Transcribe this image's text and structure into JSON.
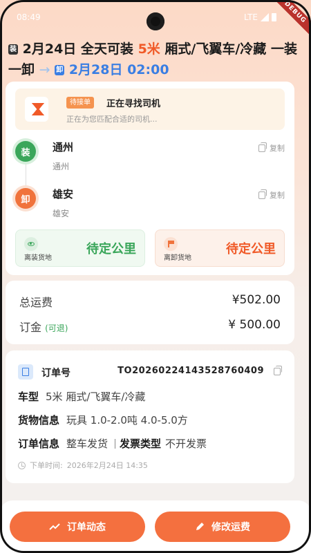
{
  "status_bar": {
    "time": "08:49",
    "network": "LTE",
    "debug": "DEBUG"
  },
  "header": {
    "load_tag": "装",
    "load_date": "2月24日",
    "load_time": "全天可装",
    "truck_length": "5米",
    "truck_type": "厢式/飞翼车/冷藏",
    "load_mode": "一装一卸",
    "arrow": "→",
    "unload_tag": "卸",
    "unload_datetime": "2月28日 02:00"
  },
  "status": {
    "badge": "待接单",
    "title": "正在寻找司机",
    "subtitle": "正在为您匹配合适的司机..."
  },
  "stops": [
    {
      "tag": "装",
      "name": "通州",
      "address": "通州",
      "copy_label": "复制"
    },
    {
      "tag": "卸",
      "name": "雄安",
      "address": "雄安",
      "copy_label": "复制"
    }
  ],
  "distances": {
    "load": {
      "caption": "离装货地",
      "value": "待定公里"
    },
    "unload": {
      "caption": "离卸货地",
      "value": "待定公里"
    }
  },
  "fees": {
    "total_label": "总运费",
    "total_value": "¥502.00",
    "deposit_label": "订金",
    "deposit_note": "(可退)",
    "deposit_value": "¥ 500.00"
  },
  "order": {
    "label": "订单号",
    "number": "TO20260224143528760409",
    "vehicle_label": "车型",
    "vehicle_value": "5米 厢式/飞翼车/冷藏",
    "cargo_label": "货物信息",
    "cargo_value": "玩具 1.0-2.0吨 4.0-5.0方",
    "order_info_label": "订单信息",
    "order_info_value": "整车发货",
    "invoice_label": "发票类型",
    "invoice_value": "不开发票",
    "time_label": "下单时间:",
    "time_value": "2026年2月24日 14:35"
  },
  "actions": {
    "timeline_button": "订单动态",
    "edit_fee_button": "修改运费"
  },
  "colors": {
    "accent": "#f4703f",
    "green": "#3aa65a",
    "blue": "#3a7ee3"
  }
}
